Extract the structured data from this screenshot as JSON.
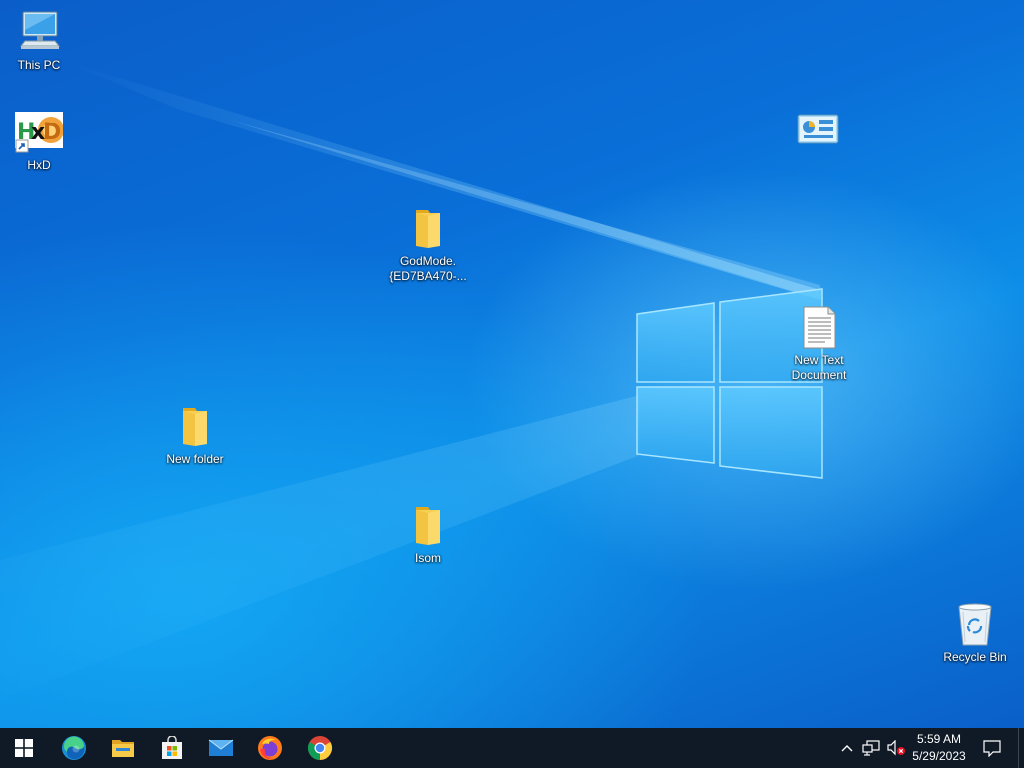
{
  "desktop": {
    "icons": [
      {
        "label": "This PC",
        "icon": "computer-icon"
      },
      {
        "label": "HxD",
        "icon": "hxd-app-icon"
      },
      {
        "label": "",
        "icon": "control-panel-icon"
      },
      {
        "label": "GodMode.\n{ED7BA470-...",
        "icon": "folder-icon"
      },
      {
        "label": "New Text\nDocument",
        "icon": "text-document-icon"
      },
      {
        "label": "New folder",
        "icon": "folder-icon"
      },
      {
        "label": "Isom",
        "icon": "folder-icon"
      },
      {
        "label": "Recycle Bin",
        "icon": "recycle-bin-icon"
      }
    ]
  },
  "taskbar": {
    "pinned": [
      {
        "name": "Start",
        "icon": "windows-start-icon"
      },
      {
        "name": "Microsoft Edge",
        "icon": "edge-icon"
      },
      {
        "name": "File Explorer",
        "icon": "file-explorer-icon"
      },
      {
        "name": "Microsoft Store",
        "icon": "store-icon"
      },
      {
        "name": "Mail",
        "icon": "mail-icon"
      },
      {
        "name": "Firefox",
        "icon": "firefox-icon"
      },
      {
        "name": "Google Chrome",
        "icon": "chrome-icon"
      }
    ],
    "tray": {
      "icons": [
        "chevron-up-icon",
        "network-icon",
        "volume-muted-icon",
        "notifications-icon"
      ]
    },
    "clock": {
      "time": "5:59 AM",
      "date": "5/29/2023"
    }
  },
  "colors": {
    "taskbar_bg": "#101a27",
    "desktop_accent": "#0a63c9",
    "folder": "#f5c542"
  }
}
